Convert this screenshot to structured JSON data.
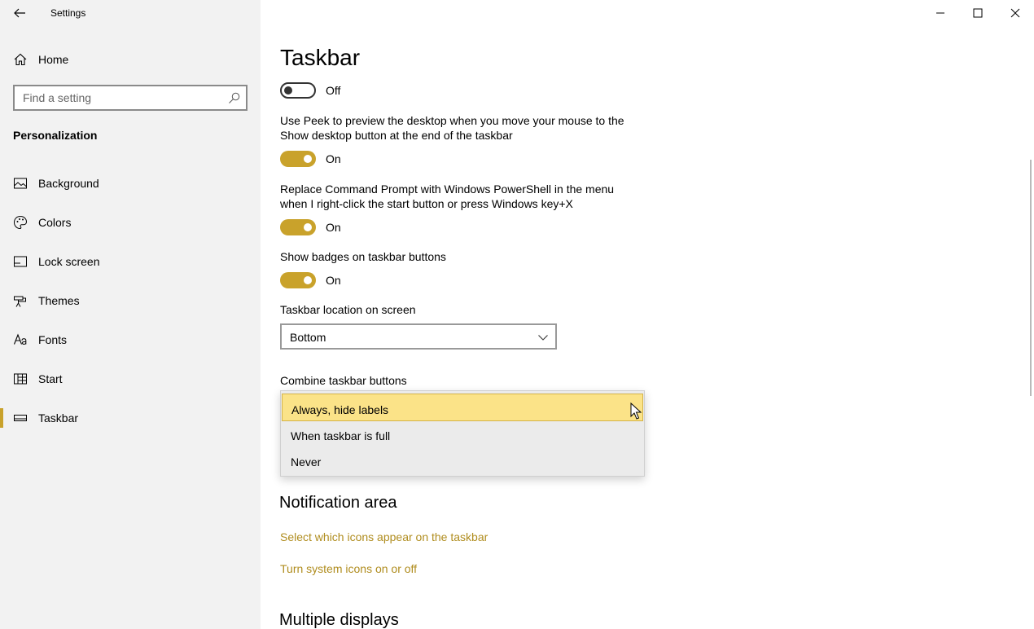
{
  "window": {
    "title": "Settings"
  },
  "sidebar": {
    "home_label": "Home",
    "search_placeholder": "Find a setting",
    "section": "Personalization",
    "items": [
      {
        "label": "Background",
        "icon": "picture-icon"
      },
      {
        "label": "Colors",
        "icon": "palette-icon"
      },
      {
        "label": "Lock screen",
        "icon": "lock-screen-icon"
      },
      {
        "label": "Themes",
        "icon": "brush-icon"
      },
      {
        "label": "Fonts",
        "icon": "font-icon"
      },
      {
        "label": "Start",
        "icon": "start-grid-icon"
      },
      {
        "label": "Taskbar",
        "icon": "taskbar-icon",
        "active": true
      }
    ]
  },
  "main": {
    "title": "Taskbar",
    "first_toggle_state": "Off",
    "settings": [
      {
        "desc": "Use Peek to preview the desktop when you move your mouse to the Show desktop button at the end of the taskbar",
        "state": "On"
      },
      {
        "desc": "Replace Command Prompt with Windows PowerShell in the menu when I right-click the start button or press Windows key+X",
        "state": "On"
      },
      {
        "desc": "Show badges on taskbar buttons",
        "state": "On"
      }
    ],
    "location_label": "Taskbar location on screen",
    "location_value": "Bottom",
    "combine_label": "Combine taskbar buttons",
    "combine_options": [
      "Always, hide labels",
      "When taskbar is full",
      "Never"
    ],
    "combine_selected": "Always, hide labels",
    "notification_heading": "Notification area",
    "links": [
      "Select which icons appear on the taskbar",
      "Turn system icons on or off"
    ],
    "multiple_displays_heading": "Multiple displays"
  },
  "colors": {
    "accent": "#c9a22b",
    "link": "#b08d1f",
    "selected_option": "#fbe388",
    "sidebar_bg": "#f2f2f2"
  }
}
